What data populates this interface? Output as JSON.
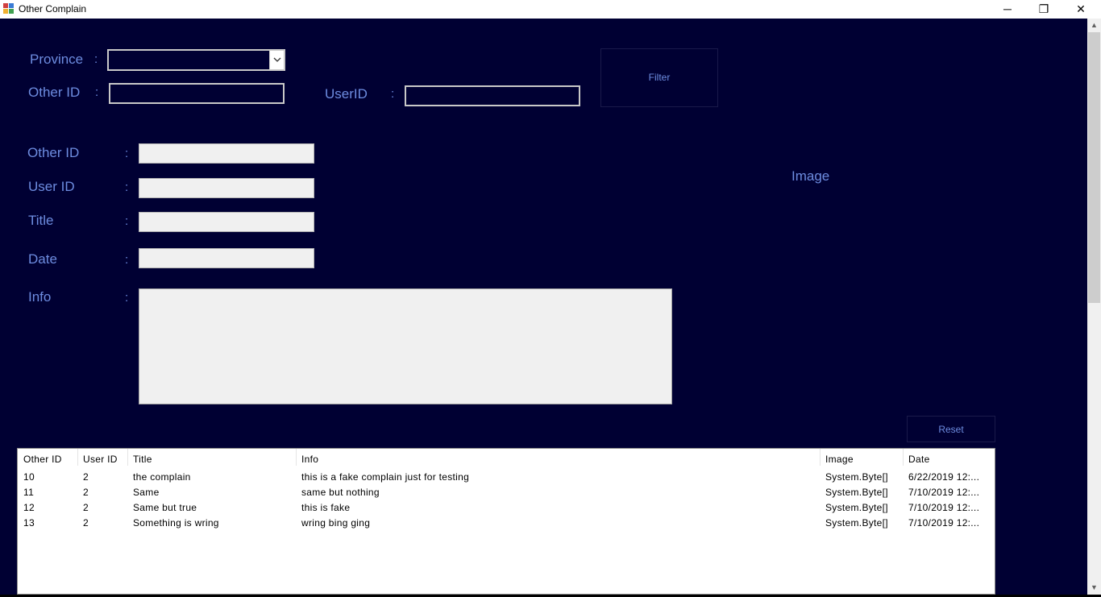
{
  "window": {
    "title": "Other Complain",
    "minimize_glyph": "─",
    "restore_glyph": "❐",
    "close_glyph": "✕"
  },
  "filter": {
    "province_label": "Province",
    "province_value": "",
    "other_id_label": "Other ID",
    "other_id_value": "",
    "user_id_label": "UserID",
    "user_id_value": "",
    "filter_button": "Filter"
  },
  "details": {
    "other_id_label": "Other ID",
    "user_id_label": "User ID",
    "title_label": "Title",
    "date_label": "Date",
    "info_label": "Info",
    "image_label": "Image",
    "colon": ":",
    "reset_button": "Reset"
  },
  "table": {
    "columns": [
      "Other ID",
      "User ID",
      "Title",
      "Info",
      "Image",
      "Date"
    ],
    "rows": [
      [
        "10",
        "2",
        "the complain",
        "this is a fake complain just for testing",
        "System.Byte[]",
        "6/22/2019 12:..."
      ],
      [
        "11",
        "2",
        "Same",
        "same but nothing",
        "System.Byte[]",
        "7/10/2019 12:..."
      ],
      [
        "12",
        "2",
        "Same but true",
        "this is fake",
        "System.Byte[]",
        "7/10/2019 12:..."
      ],
      [
        "13",
        "2",
        "Something is wring",
        "wring bing ging",
        "System.Byte[]",
        "7/10/2019 12:..."
      ]
    ]
  },
  "colors": {
    "background": "#000033",
    "label": "#6d8ce0"
  },
  "icons": {
    "app": "app-icon",
    "dropdown": "chevron-down-icon",
    "scroll_up": "scroll-up-arrow-icon",
    "scroll_down": "scroll-down-arrow-icon"
  }
}
